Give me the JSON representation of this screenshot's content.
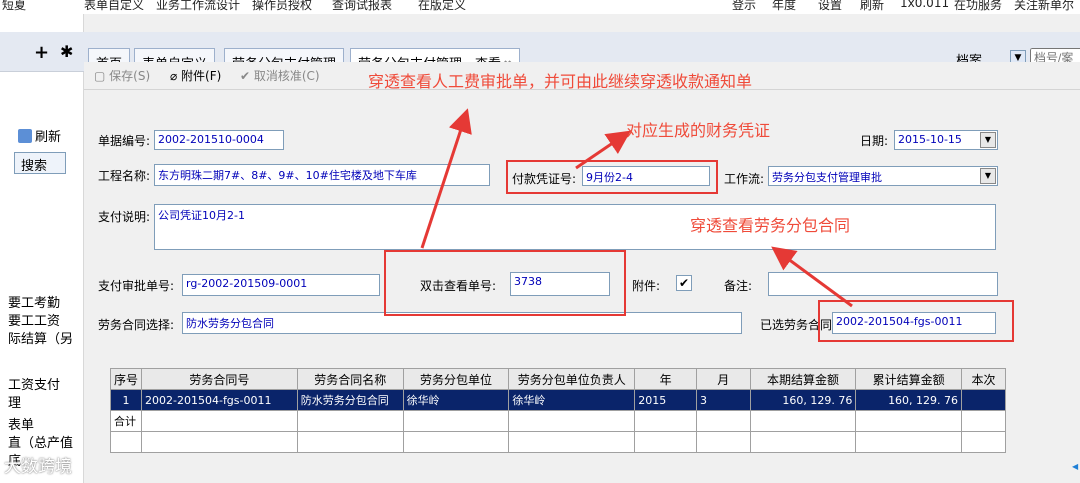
{
  "topbar": {
    "left_items": [
      "短夏",
      "表单自定义",
      "业务工作流设计",
      "操作员授权",
      "查询试报表",
      "在版定义"
    ],
    "right_items": [
      "登示",
      "年度",
      "设置",
      "刷新",
      "1x0.011",
      "在功服务",
      "关注新单尔"
    ]
  },
  "sidebar": {
    "refresh_label": "刷新",
    "search_label": "搜索",
    "items": [
      "要工考勤",
      "要工工资",
      "际结算（另",
      "工资支付",
      "理",
      "表单",
      "直（总产值",
      "底"
    ]
  },
  "tabs": [
    {
      "label": "首页"
    },
    {
      "label": "表单自定义"
    },
    {
      "label": "劳务分包支付管理"
    },
    {
      "label": "劳务分包支付管理 - 查看",
      "active": true
    }
  ],
  "archive": {
    "label": "档案",
    "placeholder": "档号/案"
  },
  "toolbar": {
    "save": "保存(S)",
    "attach": "附件(F)",
    "cancel": "取消核准(C)"
  },
  "annotations": {
    "top": "穿透查看人工费审批单，并可由此继续穿透收款通知单",
    "voucher": "对应生成的财务凭证",
    "contract": "穿透查看劳务分包合同"
  },
  "form": {
    "doc_no_label": "单据编号:",
    "doc_no": "2002-201510-0004",
    "date_label": "日期:",
    "date": "2015-10-15",
    "project_label": "工程名称:",
    "project": "东方明珠二期7#、8#、9#、10#住宅楼及地下车库",
    "voucher_label": "付款凭证号:",
    "voucher": "9月份2-4",
    "workflow_label": "工作流:",
    "workflow": "劳务分包支付管理审批",
    "desc_label": "支付说明:",
    "desc": "公司凭证10月2-1",
    "approval_label": "支付审批单号:",
    "approval": "rg-2002-201509-0001",
    "dbl_label": "双击查看单号:",
    "dbl": "3738",
    "attach_label": "附件:",
    "attach_checked": true,
    "note_label": "备注:",
    "note": "",
    "contract_sel_label": "劳务合同选择:",
    "contract_sel": "防水劳务分包合同",
    "selected_contract_label": "已选劳务合同:",
    "selected_contract": "2002-201504-fgs-0011"
  },
  "grid": {
    "headers": [
      "序号",
      "劳务合同号",
      "劳务合同名称",
      "劳务分包单位",
      "劳务分包单位负责人",
      "年",
      "月",
      "本期结算金额",
      "累计结算金额",
      "本次"
    ],
    "rows": [
      [
        "1",
        "2002-201504-fgs-0011",
        "防水劳务分包合同",
        "徐华岭",
        "徐华岭",
        "2015",
        "3",
        "160, 129. 76",
        "160, 129. 76",
        ""
      ]
    ],
    "total_label": "合计"
  },
  "watermark": "大数跨境",
  "colors": {
    "annotation_red": "#ef4b3a",
    "selected_row": "#0a246a",
    "field_text": "#0000b8"
  }
}
